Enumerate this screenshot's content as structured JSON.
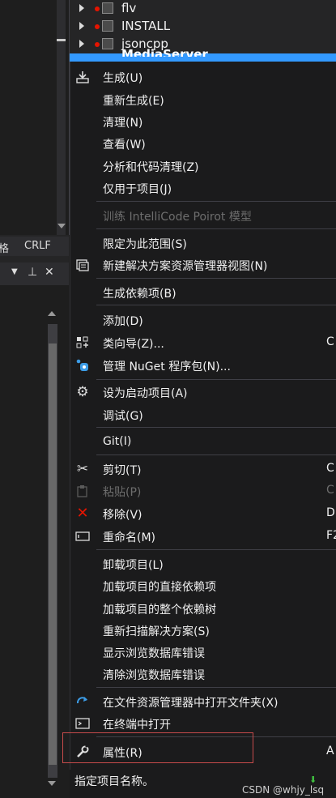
{
  "tree": {
    "items": [
      {
        "label": "flv"
      },
      {
        "label": "INSTALL"
      },
      {
        "label": "jsoncpp"
      },
      {
        "label": "MediaServer"
      }
    ]
  },
  "left_panel": {
    "status_fragment": "格",
    "line_ending": "CRLF",
    "pin_icon": "pin-icon",
    "close_icon": "close-icon"
  },
  "context_menu": {
    "items": [
      {
        "label": "生成(U)",
        "icon": "build-icon"
      },
      {
        "label": "重新生成(E)"
      },
      {
        "label": "清理(N)"
      },
      {
        "label": "查看(W)"
      },
      {
        "label": "分析和代码清理(Z)"
      },
      {
        "label": "仅用于项目(J)"
      },
      {
        "label": "训练 IntelliCode Poirot 模型",
        "disabled": true
      },
      {
        "label": "限定为此范围(S)"
      },
      {
        "label": "新建解决方案资源管理器视图(N)",
        "icon": "new-view-icon"
      },
      {
        "label": "生成依赖项(B)"
      },
      {
        "label": "添加(D)"
      },
      {
        "label": "类向导(Z)...",
        "shortcut": "C",
        "icon": "class-wizard-icon"
      },
      {
        "label": "管理 NuGet 程序包(N)...",
        "icon": "nuget-icon"
      },
      {
        "label": "设为启动项目(A)",
        "icon": "gear-icon"
      },
      {
        "label": "调试(G)"
      },
      {
        "label": "Git(I)"
      },
      {
        "label": "剪切(T)",
        "shortcut": "C",
        "icon": "cut-icon"
      },
      {
        "label": "粘贴(P)",
        "shortcut": "C",
        "disabled": true,
        "icon": "paste-icon"
      },
      {
        "label": "移除(V)",
        "shortcut": "D",
        "icon": "remove-icon"
      },
      {
        "label": "重命名(M)",
        "shortcut": "F2",
        "icon": "rename-icon"
      },
      {
        "label": "卸载项目(L)"
      },
      {
        "label": "加载项目的直接依赖项"
      },
      {
        "label": "加载项目的整个依赖树"
      },
      {
        "label": "重新扫描解决方案(S)"
      },
      {
        "label": "显示浏览数据库错误"
      },
      {
        "label": "清除浏览数据库错误"
      },
      {
        "label": "在文件资源管理器中打开文件夹(X)",
        "icon": "open-folder-icon"
      },
      {
        "label": "在终端中打开",
        "icon": "terminal-icon"
      },
      {
        "label": "属性(R)",
        "shortcut": "A",
        "icon": "wrench-icon"
      }
    ]
  },
  "status": {
    "text": "指定项目名称。",
    "watermark": "CSDN @whjy_lsq"
  },
  "colors": {
    "accent": "#3399ff",
    "highlight_border": "#c74b4b",
    "remove_icon": "#e51400",
    "nuget_icon": "#3c9ce6"
  }
}
